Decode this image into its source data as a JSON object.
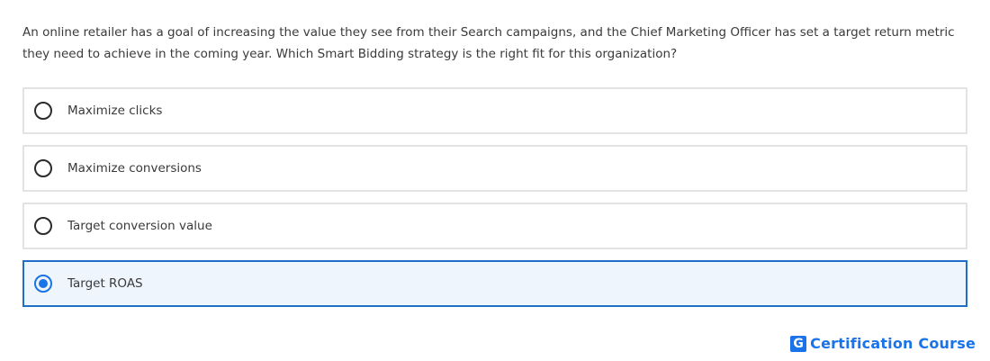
{
  "question": {
    "text": "An online retailer has a goal of increasing the value they see from their Search campaigns, and the Chief Marketing Officer has set a target return metric they need to achieve in the coming year. Which Smart Bidding strategy is the right fit for this organization?"
  },
  "options": [
    {
      "label": "Maximize clicks",
      "selected": false
    },
    {
      "label": "Maximize conversions",
      "selected": false
    },
    {
      "label": "Target conversion value",
      "selected": false
    },
    {
      "label": "Target ROAS",
      "selected": true
    }
  ],
  "brand": {
    "logo_letter": "G",
    "text": "Certification Course"
  },
  "colors": {
    "accent": "#1a73e8",
    "selected_bg": "#eef5fd",
    "option_border": "#e3e3e3"
  }
}
